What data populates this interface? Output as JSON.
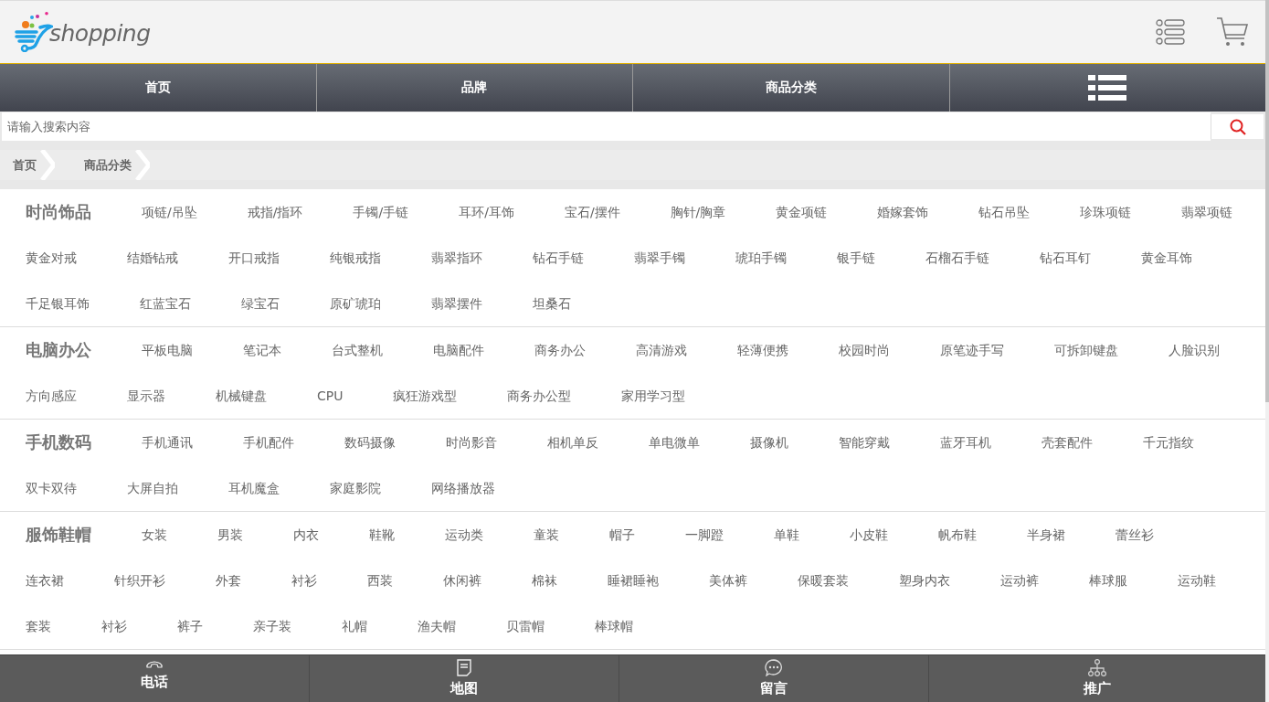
{
  "header": {
    "logo_text": "shopping"
  },
  "nav": [
    {
      "kind": "text",
      "label": "首页"
    },
    {
      "kind": "text",
      "label": "品牌"
    },
    {
      "kind": "text",
      "label": "商品分类"
    },
    {
      "kind": "menu"
    }
  ],
  "search": {
    "placeholder": "请输入搜索内容"
  },
  "breadcrumb": [
    "首页",
    "商品分类"
  ],
  "categories": [
    {
      "title": "时尚饰品",
      "items": [
        "项链/吊坠",
        "戒指/指环",
        "手镯/手链",
        "耳环/耳饰",
        "宝石/摆件",
        "胸针/胸章",
        "黄金项链",
        "婚嫁套饰",
        "钻石吊坠",
        "珍珠项链",
        "翡翠项链",
        "黄金对戒",
        "结婚钻戒",
        "开口戒指",
        "纯银戒指",
        "翡翠指环",
        "钻石手链",
        "翡翠手镯",
        "琥珀手镯",
        "银手链",
        "石榴石手链",
        "钻石耳钉",
        "黄金耳饰",
        "千足银耳饰",
        "红蓝宝石",
        "绿宝石",
        "原矿琥珀",
        "翡翠摆件",
        "坦桑石"
      ]
    },
    {
      "title": "电脑办公",
      "items": [
        "平板电脑",
        "笔记本",
        "台式整机",
        "电脑配件",
        "商务办公",
        "高清游戏",
        "轻薄便携",
        "校园时尚",
        "原笔迹手写",
        "可拆卸键盘",
        "人脸识别",
        "方向感应",
        "显示器",
        "机械键盘",
        "CPU",
        "疯狂游戏型",
        "商务办公型",
        "家用学习型"
      ]
    },
    {
      "title": "手机数码",
      "items": [
        "手机通讯",
        "手机配件",
        "数码摄像",
        "时尚影音",
        "相机单反",
        "单电微单",
        "摄像机",
        "智能穿戴",
        "蓝牙耳机",
        "壳套配件",
        "千元指纹",
        "双卡双待",
        "大屏自拍",
        "耳机魔盒",
        "家庭影院",
        "网络播放器"
      ]
    },
    {
      "title": "服饰鞋帽",
      "items": [
        "女装",
        "男装",
        "内衣",
        "鞋靴",
        "运动类",
        "童装",
        "帽子",
        "一脚蹬",
        "单鞋",
        "小皮鞋",
        "帆布鞋",
        "半身裙",
        "蕾丝衫",
        "连衣裙",
        "针织开衫",
        "外套",
        "衬衫",
        "西装",
        "休闲裤",
        "棉袜",
        "睡裙睡袍",
        "美体裤",
        "保暖套装",
        "塑身内衣",
        "运动裤",
        "棒球服",
        "运动鞋",
        "套装",
        "衬衫",
        "裤子",
        "亲子装",
        "礼帽",
        "渔夫帽",
        "贝雷帽",
        "棒球帽"
      ]
    }
  ],
  "footer": [
    {
      "label": "电话"
    },
    {
      "label": "地图"
    },
    {
      "label": "留言"
    },
    {
      "label": "推广"
    }
  ]
}
